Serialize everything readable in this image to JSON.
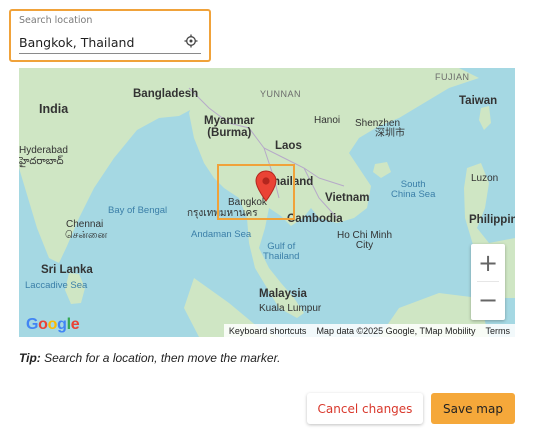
{
  "search": {
    "label": "Search location",
    "value": "Bangkok, Thailand",
    "placeholder": ""
  },
  "map": {
    "labels": {
      "india": "India",
      "bangladesh": "Bangladesh",
      "myanmar": "Myanmar\n(Burma)",
      "laos": "Laos",
      "thailand": "Thailand",
      "vietnam": "Vietnam",
      "cambodia": "Cambodia",
      "malaysia": "Malaysia",
      "taiwan": "Taiwan",
      "philippines": "Philippin",
      "sri_lanka": "Sri Lanka",
      "hyderabad": "Hyderabad",
      "hyderabad_native": "హైదరాబాద్",
      "chennai": "Chennai",
      "chennai_native": "சென்னை",
      "bangkok": "Bangkok",
      "bangkok_native": "กรุงเทพมหานคร",
      "hanoi": "Hanoi",
      "shenzhen": "Shenzhen",
      "shenzhen_native": "深圳市",
      "ho_chi_minh": "Ho Chi Minh\nCity",
      "kuala_lumpur": "Kuala Lumpur",
      "luzon": "Luzon",
      "yunnan": "YUNNAN",
      "fujian": "FUJIAN",
      "bay_of_bengal": "Bay of Bengal",
      "andaman_sea": "Andaman Sea",
      "gulf_of_thailand": "Gulf of\nThailand",
      "south_china_sea": "South\nChina Sea",
      "laccadive_sea": "Laccadive Sea"
    },
    "zoom_in": "+",
    "zoom_out": "−",
    "google": [
      "G",
      "o",
      "o",
      "g",
      "l",
      "e"
    ],
    "google_colors": [
      "#4285F4",
      "#EA4335",
      "#FBBC05",
      "#4285F4",
      "#34A853",
      "#EA4335"
    ],
    "attribution": {
      "shortcuts": "Keyboard shortcuts",
      "data": "Map data ©2025 Google, TMap Mobility",
      "terms": "Terms"
    },
    "marker_color": "#EA4335"
  },
  "tip": {
    "prefix": "Tip:",
    "text": " Search for a location, then move the marker."
  },
  "actions": {
    "cancel": "Cancel changes",
    "save": "Save map"
  },
  "colors": {
    "accent": "#f0a23a",
    "save_bg": "#f5a83a",
    "cancel_text": "#d9382c",
    "water": "#a5d8e3",
    "land": "#cfe6c4"
  }
}
